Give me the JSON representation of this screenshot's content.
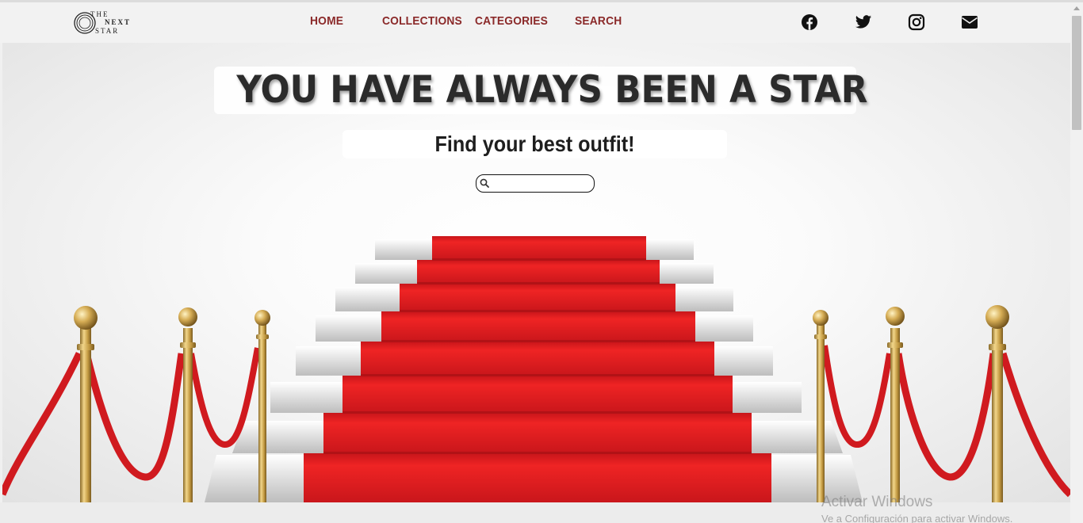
{
  "header": {
    "logo_lines": [
      "THE",
      "NEXT",
      "STAR"
    ],
    "nav": {
      "home": "HOME",
      "collections": "COLLECTIONS",
      "categories": "CATEGORIES",
      "search": "SEARCH"
    },
    "social_icons": [
      "facebook-icon",
      "twitter-icon",
      "instagram-icon",
      "envelope-icon"
    ]
  },
  "hero": {
    "headline": "YOU HAVE ALWAYS BEEN A STAR",
    "subheadline": "Find your best outfit!",
    "search": {
      "value": "",
      "placeholder": ""
    }
  },
  "watermark": {
    "line1": "Activar Windows",
    "line2": "Ve a Configuración para activar Windows."
  },
  "colors": {
    "nav_text": "#8b2a2a",
    "carpet": "#e11d1d",
    "brass": "#c9a24a"
  }
}
